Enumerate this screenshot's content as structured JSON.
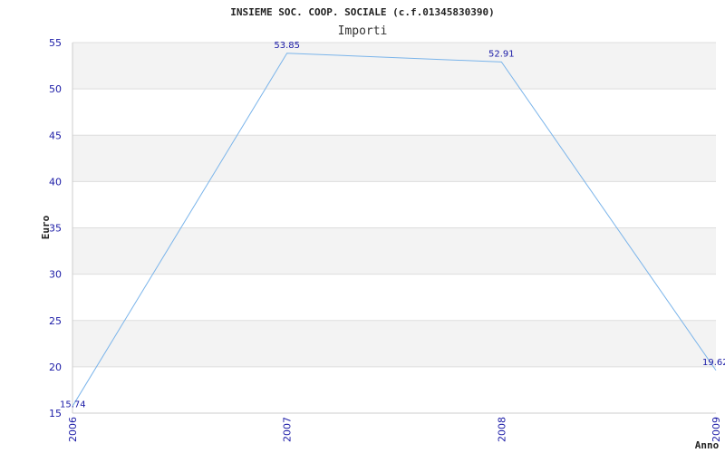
{
  "chart_data": {
    "type": "line",
    "title": "INSIEME SOC. COOP. SOCIALE (c.f.01345830390)",
    "subtitle": "Importi",
    "xlabel": "Anno",
    "ylabel": "Euro",
    "categories": [
      "2006",
      "2007",
      "2008",
      "2009"
    ],
    "values": [
      15.74,
      53.85,
      52.91,
      19.62
    ],
    "data_labels": [
      "15.74",
      "53.85",
      "52.91",
      "19.62"
    ],
    "ylim": [
      15,
      55
    ],
    "yticks": [
      15,
      20,
      25,
      30,
      35,
      40,
      45,
      50,
      55
    ],
    "ytick_labels": [
      "15",
      "20",
      "25",
      "30",
      "35",
      "40",
      "45",
      "50",
      "55"
    ],
    "grid": true,
    "legend": "none",
    "colors": {
      "line": "#7ab4ea",
      "band": "#f3f3f3",
      "grid": "#dddddd",
      "tick_text": "#1a1aa6"
    }
  }
}
